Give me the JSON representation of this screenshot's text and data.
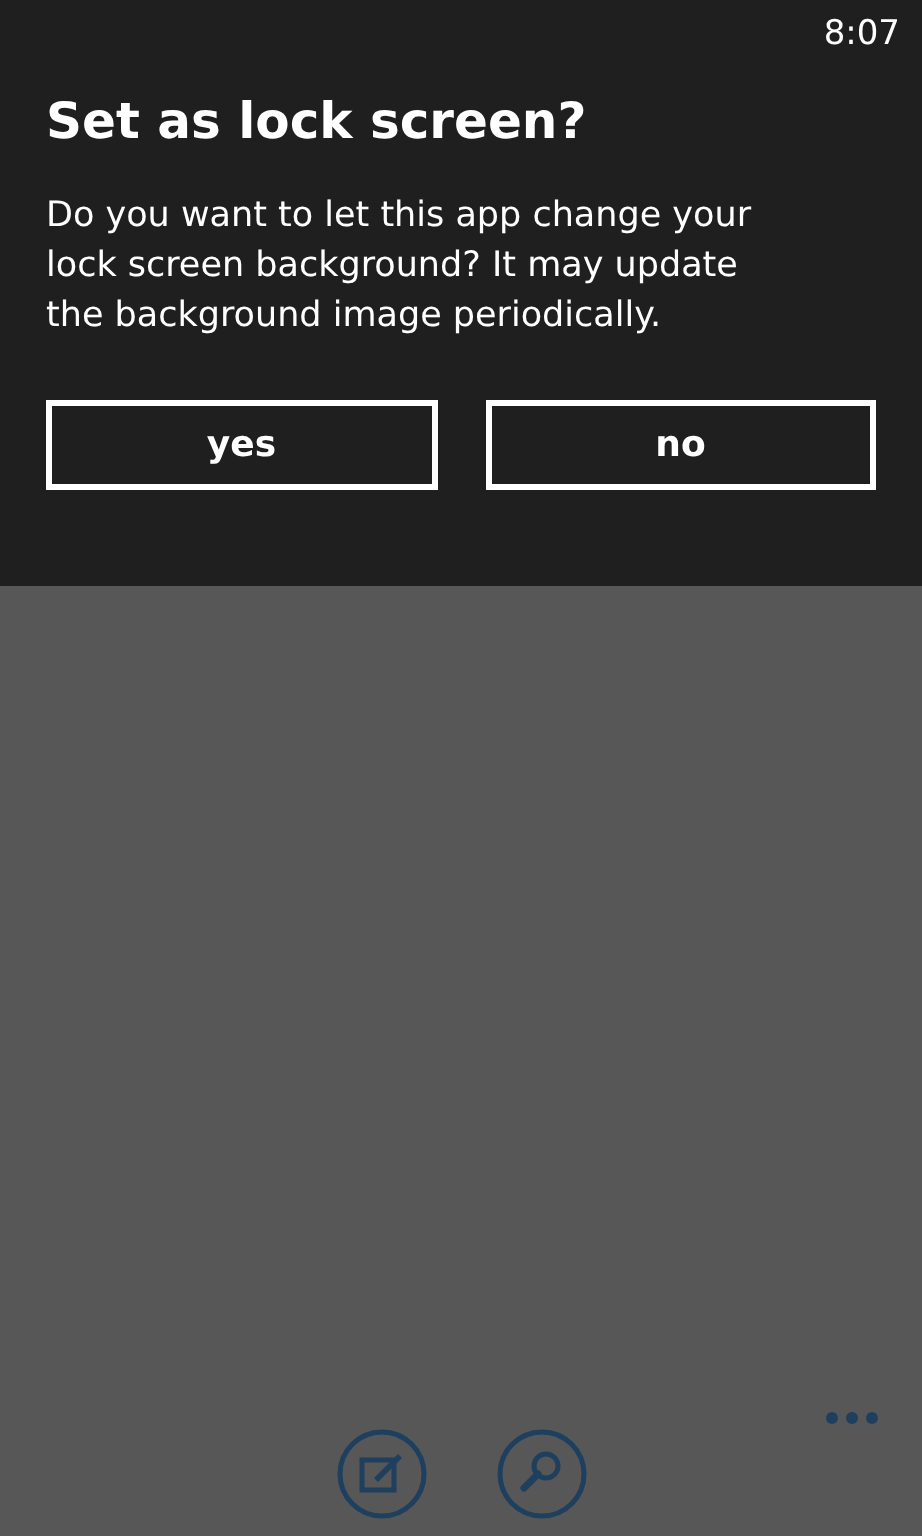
{
  "status_bar": {
    "time": "8:07"
  },
  "dialog": {
    "title": "Set as lock screen?",
    "message": "Do you want to let this app change your lock screen background? It may update the background image periodically.",
    "buttons": [
      "yes",
      "no"
    ]
  },
  "app_bar": {
    "buttons": [
      {
        "kind": "edit"
      },
      {
        "kind": "search"
      },
      {
        "kind": "more"
      }
    ]
  }
}
